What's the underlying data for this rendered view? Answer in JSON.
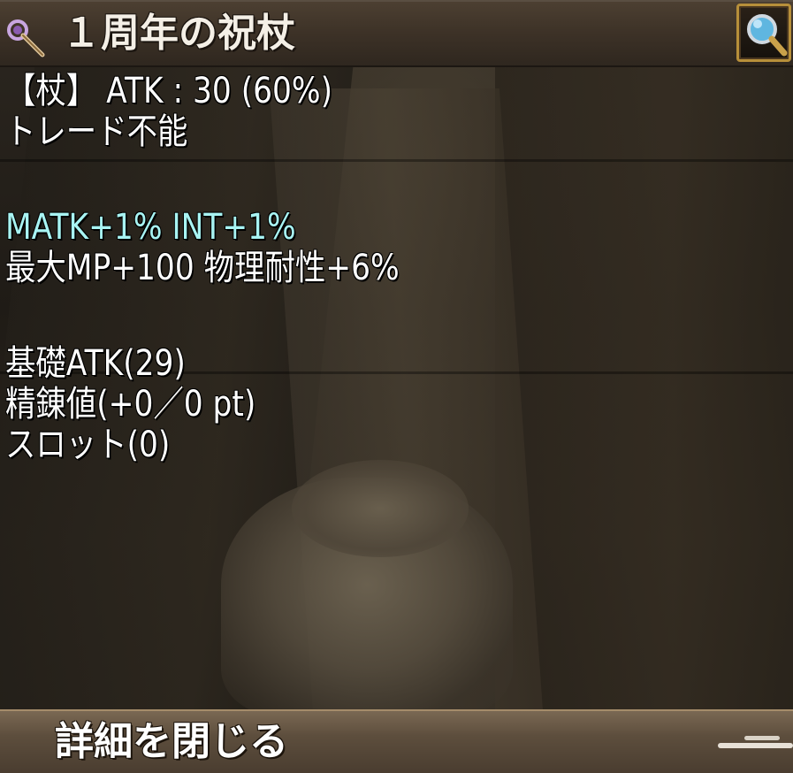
{
  "header": {
    "title": "１周年の祝杖",
    "item_icon": "staff-icon",
    "zoom_icon": "magnifier-icon"
  },
  "stats": {
    "line1": "【杖】 ATK : 30 (60%)",
    "line2": "トレード不能",
    "line3": "MATK+1% INT+1%",
    "line4": "最大MP+100 物理耐性+6%",
    "line5": "基礎ATK(29)",
    "line6": "精錬値(+0／0 pt)",
    "line7": "スロット(0)"
  },
  "footer": {
    "close_label": "詳細を閉じる"
  },
  "colors": {
    "text": "#ffffff",
    "highlight_text": "#a8f4f3",
    "header_bg": "#3d3227",
    "footer_bg": "#5d4e3d",
    "button_border": "#b78f3a"
  }
}
